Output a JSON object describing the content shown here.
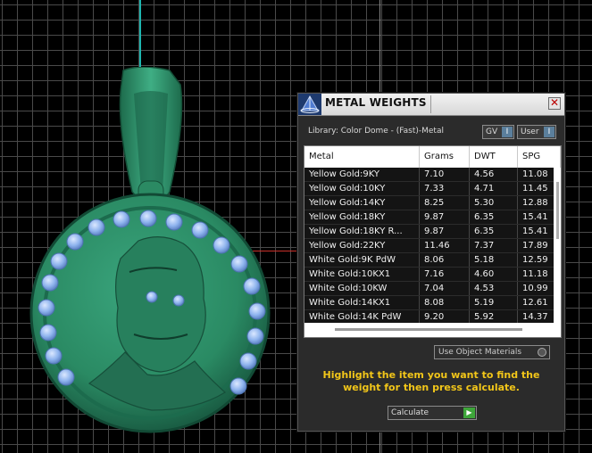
{
  "dialog": {
    "title": "METAL WEIGHTS",
    "close_glyph": "✕",
    "library_label": "Library: Color Dome - (Fast)-Metal",
    "gv_toggle": "GV",
    "user_toggle": "User",
    "toggle_indicator": "I",
    "table": {
      "columns": [
        "Metal",
        "Grams",
        "DWT",
        "SPG"
      ],
      "rows": [
        [
          "Yellow Gold:9KY",
          "7.10",
          "4.56",
          "11.08"
        ],
        [
          "Yellow Gold:10KY",
          "7.33",
          "4.71",
          "11.45"
        ],
        [
          "Yellow Gold:14KY",
          "8.25",
          "5.30",
          "12.88"
        ],
        [
          "Yellow Gold:18KY",
          "9.87",
          "6.35",
          "15.41"
        ],
        [
          "Yellow Gold:18KY R...",
          "9.87",
          "6.35",
          "15.41"
        ],
        [
          "Yellow Gold:22KY",
          "11.46",
          "7.37",
          "17.89"
        ],
        [
          "White Gold:9K PdW",
          "8.06",
          "5.18",
          "12.59"
        ],
        [
          "White Gold:10KX1",
          "7.16",
          "4.60",
          "11.18"
        ],
        [
          "White Gold:10KW",
          "7.04",
          "4.53",
          "10.99"
        ],
        [
          "White Gold:14KX1",
          "8.08",
          "5.19",
          "12.61"
        ],
        [
          "White Gold:14K PdW",
          "9.20",
          "5.92",
          "14.37"
        ]
      ]
    },
    "use_object_materials": "Use Object Materials",
    "instructions": "Highlight the item you want to find the weight for then press calculate.",
    "calculate_label": "Calculate",
    "calculate_glyph": "▶"
  },
  "colors": {
    "pendant_green": "#2f8f6a",
    "stone_blue": "#8fb4ee",
    "instruction_yellow": "#f2c619",
    "axis_cyan": "#1fb6b0",
    "axis_red": "#c8302a"
  },
  "icons": {
    "app": "pyramid-logo-icon",
    "close": "close-icon",
    "calculate": "play-icon"
  }
}
